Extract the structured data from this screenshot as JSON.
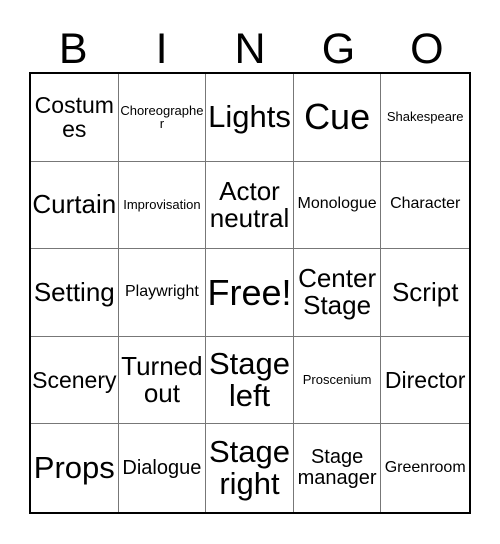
{
  "card": {
    "title": "Bingo Card",
    "header_letters": [
      "B",
      "I",
      "N",
      "G",
      "O"
    ],
    "free_space_label": "Free!",
    "colors": {
      "background": "#ffffff",
      "text": "#000000",
      "grid_line": "#777777",
      "outer_border": "#000000"
    },
    "grid": {
      "columns": 5,
      "rows": 5,
      "cells": [
        [
          {
            "text": "Costumes",
            "size": "m"
          },
          {
            "text": "Choreographer",
            "size": "xxs"
          },
          {
            "text": "Lights",
            "size": "xl"
          },
          {
            "text": "Cue",
            "size": "xxl"
          },
          {
            "text": "Shakespeare",
            "size": "xxs"
          }
        ],
        [
          {
            "text": "Curtain",
            "size": "l"
          },
          {
            "text": "Improvisation",
            "size": "xxs"
          },
          {
            "text": "Actor neutral",
            "size": "l"
          },
          {
            "text": "Monologue",
            "size": "xs"
          },
          {
            "text": "Character",
            "size": "xs"
          }
        ],
        [
          {
            "text": "Setting",
            "size": "l"
          },
          {
            "text": "Playwright",
            "size": "xs"
          },
          {
            "text": "Free!",
            "size": "xxl"
          },
          {
            "text": "Center Stage",
            "size": "l"
          },
          {
            "text": "Script",
            "size": "l"
          }
        ],
        [
          {
            "text": "Scenery",
            "size": "m"
          },
          {
            "text": "Turned out",
            "size": "l"
          },
          {
            "text": "Stage left",
            "size": "xl"
          },
          {
            "text": "Proscenium",
            "size": "xxs"
          },
          {
            "text": "Director",
            "size": "m"
          }
        ],
        [
          {
            "text": "Props",
            "size": "xl"
          },
          {
            "text": "Dialogue",
            "size": "s"
          },
          {
            "text": "Stage right",
            "size": "xl"
          },
          {
            "text": "Stage manager",
            "size": "s"
          },
          {
            "text": "Greenroom",
            "size": "xs"
          }
        ]
      ]
    }
  }
}
